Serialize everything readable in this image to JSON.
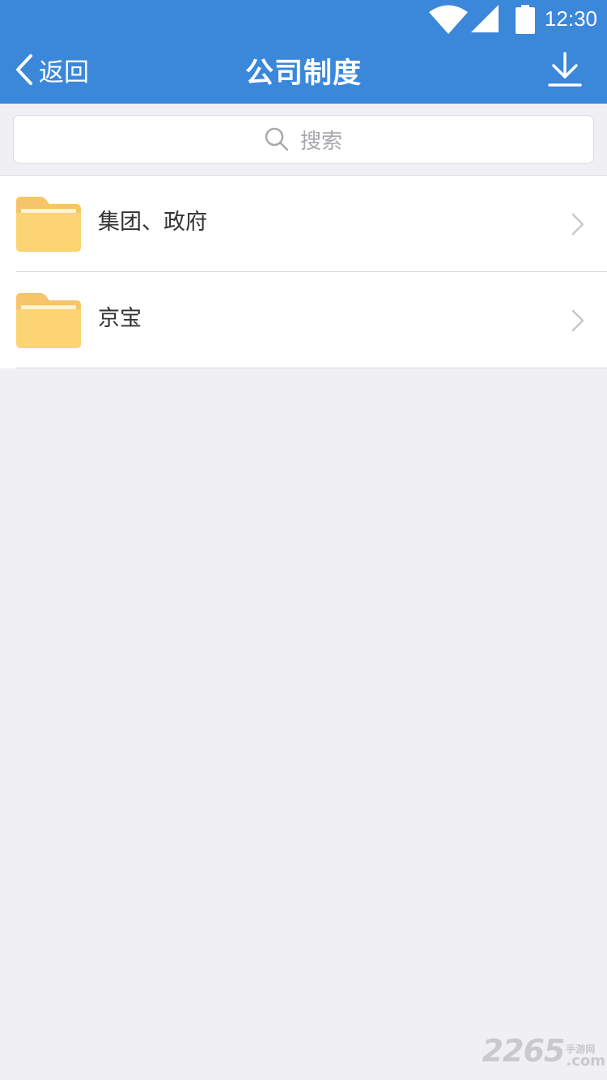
{
  "status_bar": {
    "time": "12:30",
    "icons": [
      "wifi-icon",
      "cellular-signal-icon",
      "battery-icon"
    ]
  },
  "nav": {
    "back_label": "返回",
    "title": "公司制度",
    "back_icon": "chevron-left-icon",
    "download_icon": "download-icon"
  },
  "search": {
    "placeholder": "搜索",
    "icon": "search-icon"
  },
  "folders": [
    {
      "label": "集团、政府",
      "icon": "folder-icon"
    },
    {
      "label": "京宝",
      "icon": "folder-icon"
    }
  ],
  "watermark": {
    "main": "2265",
    "cn": "手游网",
    "com": ".com"
  },
  "colors": {
    "header": "#3b87da",
    "background": "#efeff4",
    "folder": "#fcc961",
    "text": "#333333"
  }
}
